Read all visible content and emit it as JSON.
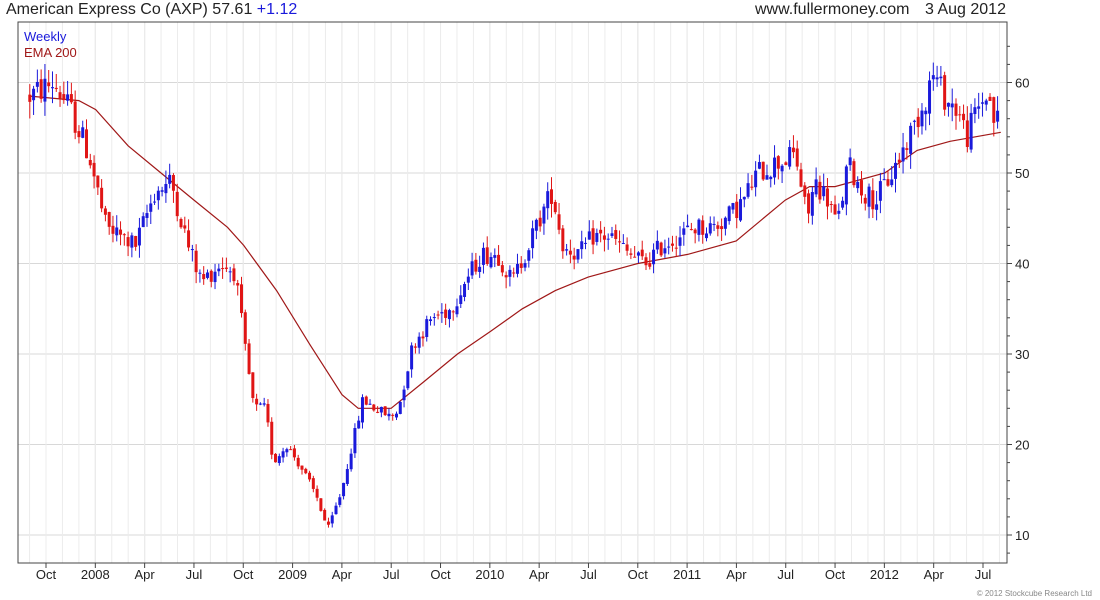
{
  "header": {
    "title": "American Express Co (AXP)",
    "price": "57.61",
    "change": "+1.12",
    "site": "www.fullermoney.com",
    "date": "3 Aug 2012"
  },
  "legend": {
    "period": "Weekly",
    "ema": "EMA 200"
  },
  "copyright": "© 2012 Stockcube Research Ltd",
  "colors": {
    "up": "#1a1adb",
    "down": "#e01515",
    "ema": "#a01818",
    "grid": "#d8d8d8",
    "frame": "#444444",
    "change": "#1a1adb"
  },
  "chart_data": {
    "type": "candlestick",
    "period": "weekly",
    "x_tick_labels": [
      "Oct",
      "2008",
      "Apr",
      "Jul",
      "Oct",
      "2009",
      "Apr",
      "Jul",
      "Oct",
      "2010",
      "Apr",
      "Jul",
      "Oct",
      "2011",
      "Apr",
      "Jul",
      "Oct",
      "2012",
      "Apr",
      "Jul"
    ],
    "y_ticks": [
      10,
      20,
      30,
      40,
      50,
      60
    ],
    "y_axis_side": "right",
    "ylim": [
      8,
      65
    ],
    "grid": true,
    "price_path": [
      [
        "2007-09-01",
        58.5
      ],
      [
        "2007-10-15",
        60
      ],
      [
        "2007-11-15",
        57
      ],
      [
        "2007-12-20",
        52
      ],
      [
        "2008-01-20",
        44
      ],
      [
        "2008-03-15",
        42
      ],
      [
        "2008-04-20",
        48
      ],
      [
        "2008-05-20",
        49
      ],
      [
        "2008-06-20",
        42
      ],
      [
        "2008-07-15",
        38
      ],
      [
        "2008-08-20",
        40
      ],
      [
        "2008-09-15",
        39
      ],
      [
        "2008-10-05",
        30
      ],
      [
        "2008-10-20",
        24
      ],
      [
        "2008-11-10",
        24
      ],
      [
        "2008-11-25",
        18
      ],
      [
        "2008-12-20",
        20
      ],
      [
        "2009-01-20",
        17
      ],
      [
        "2009-02-15",
        14
      ],
      [
        "2009-03-06",
        10.5
      ],
      [
        "2009-04-01",
        15
      ],
      [
        "2009-04-20",
        20
      ],
      [
        "2009-05-10",
        25
      ],
      [
        "2009-06-01",
        24
      ],
      [
        "2009-07-01",
        23
      ],
      [
        "2009-07-15",
        24
      ],
      [
        "2009-08-10",
        31
      ],
      [
        "2009-09-15",
        34
      ],
      [
        "2009-10-20",
        35
      ],
      [
        "2009-11-15",
        38
      ],
      [
        "2009-12-15",
        41
      ],
      [
        "2010-01-15",
        41
      ],
      [
        "2010-02-10",
        38
      ],
      [
        "2010-03-05",
        41
      ],
      [
        "2010-04-10",
        46
      ],
      [
        "2010-04-25",
        48
      ],
      [
        "2010-05-15",
        42
      ],
      [
        "2010-06-15",
        41
      ],
      [
        "2010-07-10",
        43
      ],
      [
        "2010-08-10",
        43
      ],
      [
        "2010-09-15",
        41
      ],
      [
        "2010-10-15",
        40
      ],
      [
        "2010-11-15",
        42
      ],
      [
        "2010-12-15",
        43
      ],
      [
        "2011-01-15",
        44
      ],
      [
        "2011-02-15",
        44
      ],
      [
        "2011-03-15",
        45
      ],
      [
        "2011-04-15",
        47
      ],
      [
        "2011-05-10",
        50
      ],
      [
        "2011-06-10",
        51
      ],
      [
        "2011-07-20",
        52
      ],
      [
        "2011-08-10",
        45
      ],
      [
        "2011-08-25",
        49
      ],
      [
        "2011-09-20",
        47
      ],
      [
        "2011-10-05",
        44
      ],
      [
        "2011-10-25",
        51
      ],
      [
        "2011-11-20",
        48
      ],
      [
        "2011-12-15",
        47
      ],
      [
        "2012-01-15",
        50
      ],
      [
        "2012-02-15",
        54
      ],
      [
        "2012-03-15",
        58
      ],
      [
        "2012-03-30",
        61
      ],
      [
        "2012-04-25",
        58
      ],
      [
        "2012-05-15",
        57
      ],
      [
        "2012-06-01",
        54
      ],
      [
        "2012-06-20",
        57
      ],
      [
        "2012-07-10",
        59
      ],
      [
        "2012-07-25",
        55
      ],
      [
        "2012-08-03",
        57.61
      ]
    ],
    "ema_200": [
      [
        "2007-09-01",
        58.5
      ],
      [
        "2007-12-01",
        58
      ],
      [
        "2008-01-01",
        57
      ],
      [
        "2008-03-01",
        53
      ],
      [
        "2008-05-01",
        50
      ],
      [
        "2008-07-01",
        47
      ],
      [
        "2008-09-01",
        44
      ],
      [
        "2008-10-01",
        42
      ],
      [
        "2008-12-01",
        37
      ],
      [
        "2009-02-01",
        31
      ],
      [
        "2009-04-01",
        25.5
      ],
      [
        "2009-05-01",
        24
      ],
      [
        "2009-07-01",
        24
      ],
      [
        "2009-09-01",
        27
      ],
      [
        "2009-11-01",
        30
      ],
      [
        "2010-01-01",
        32.5
      ],
      [
        "2010-03-01",
        35
      ],
      [
        "2010-05-01",
        37
      ],
      [
        "2010-07-01",
        38.5
      ],
      [
        "2010-10-01",
        40
      ],
      [
        "2011-01-01",
        41
      ],
      [
        "2011-04-01",
        42.5
      ],
      [
        "2011-07-01",
        47
      ],
      [
        "2011-08-15",
        48.5
      ],
      [
        "2011-10-01",
        48.5
      ],
      [
        "2012-01-01",
        50
      ],
      [
        "2012-03-01",
        52.5
      ],
      [
        "2012-05-01",
        53.5
      ],
      [
        "2012-08-03",
        54.5
      ]
    ]
  }
}
